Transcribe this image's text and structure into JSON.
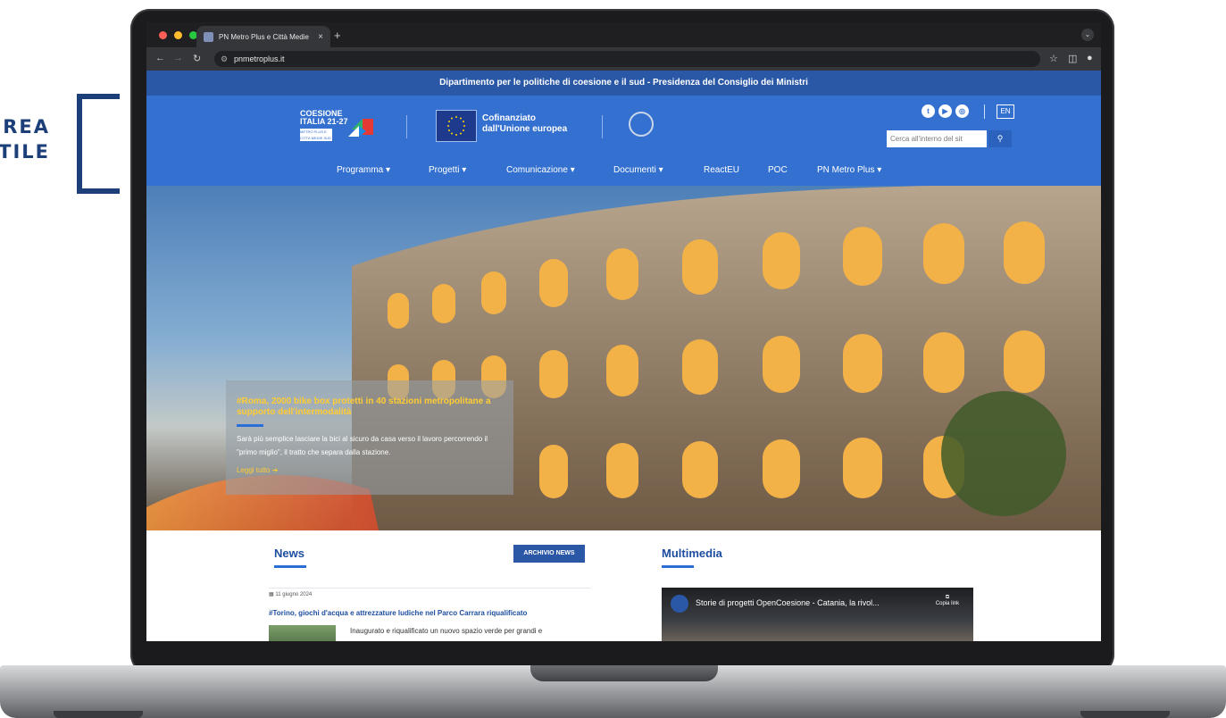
{
  "side_label": {
    "line1": "REA",
    "line2": "TILE"
  },
  "browser": {
    "tab_title": "PN Metro Plus e Città Medie",
    "tab_close": "×",
    "new_tab": "+",
    "url": "pnmetroplus.it",
    "tab_menu_icon": "chevron-down-icon"
  },
  "page": {
    "gov_bar": "Dipartimento per le politiche di coesione e il sud - Presidenza del Consiglio dei Ministri",
    "logo_coesione": {
      "line1": "COESIONE",
      "line2": "ITALIA 21-27",
      "sub": "METRO PLUS E CITTÀ MEDIE SUD"
    },
    "eu_text": {
      "line1": "Cofinanziato",
      "line2": "dall'Unione europea"
    },
    "lang": "EN",
    "search_placeholder": "Cerca all'interno del sit",
    "nav": [
      "Programma",
      "Progetti",
      "Comunicazione",
      "Documenti",
      "ReactEU",
      "POC",
      "PN Metro Plus"
    ],
    "nav_dropdown": [
      "▾",
      "▾",
      "▾",
      "▾",
      "",
      "",
      "▾"
    ],
    "hero": {
      "title": "#Roma, 2000 bike box protetti in 40 stazioni metropolitane a supporto dell'intermodalità",
      "text": "Sarà più semplice lasciare la bici al sicuro da casa verso il lavoro percorrendo il \"primo miglio\", il tratto che separa dalla stazione.",
      "link": "Leggi tutto ➔"
    },
    "news": {
      "title": "News",
      "archive_button": "ARCHIVIO NEWS",
      "date": "11 giugno 2024",
      "item_title": "#Torino, giochi d'acqua e attrezzature ludiche nel Parco Carrara riqualificato",
      "item_text": "Inaugurato e riqualificato un nuovo spazio verde per grandi e"
    },
    "multimedia": {
      "title": "Multimedia",
      "video_title": "Storie di progetti OpenCoesione - Catania, la rivol...",
      "copy_link": "Copia link"
    }
  },
  "colors": {
    "brand_blue": "#3470cf",
    "dark_blue": "#2b58a6",
    "accent_yellow": "#ffcc33"
  }
}
